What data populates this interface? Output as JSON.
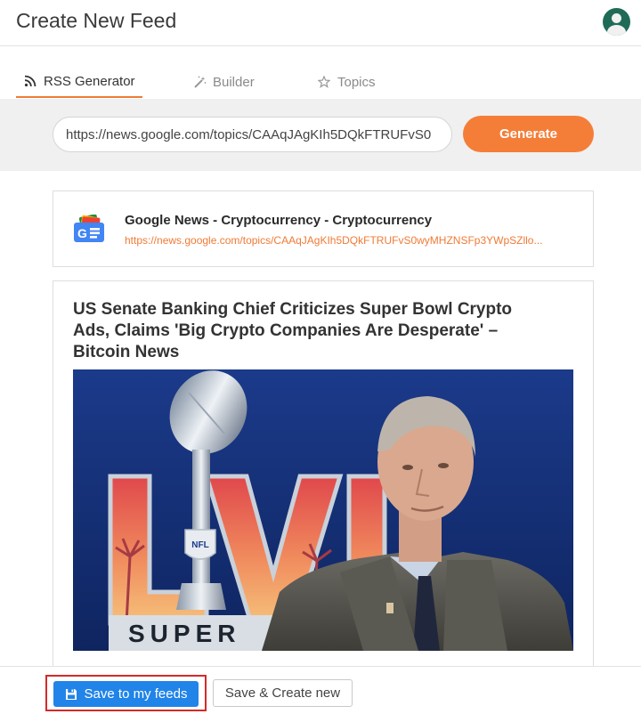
{
  "header": {
    "title": "Create New Feed",
    "avatar_icon": "user-avatar-icon"
  },
  "tabs": [
    {
      "label": "RSS Generator",
      "icon": "rss-icon",
      "active": true
    },
    {
      "label": "Builder",
      "icon": "magic-wand-icon",
      "active": false
    },
    {
      "label": "Topics",
      "icon": "star-icon",
      "active": false
    }
  ],
  "generator": {
    "url_value": "https://news.google.com/topics/CAAqJAgKIh5DQkFTRUFvS0",
    "button_label": "Generate"
  },
  "source": {
    "name": "Google News - Cryptocurrency - Cryptocurrency",
    "url": "https://news.google.com/topics/CAAqJAgKIh5DQkFTRUFvS0wyMHZNSFp3YWpSZllo...",
    "logo_icon": "google-news-logo"
  },
  "article": {
    "title": "US Senate Banking Chief Criticizes Super Bowl Crypto Ads, Claims 'Big Crypto Companies Are Desperate' – Bitcoin News",
    "image": {
      "logo_text": "NFL",
      "banner_text": "SUPER"
    }
  },
  "footer": {
    "save_label": "Save to my feeds",
    "save_icon": "floppy-disk-icon",
    "create_label": "Save & Create new"
  },
  "colors": {
    "accent": "#f47e38",
    "primary": "#2184e8",
    "highlight_border": "#d42a2a",
    "avatar": "#1f6b58"
  }
}
